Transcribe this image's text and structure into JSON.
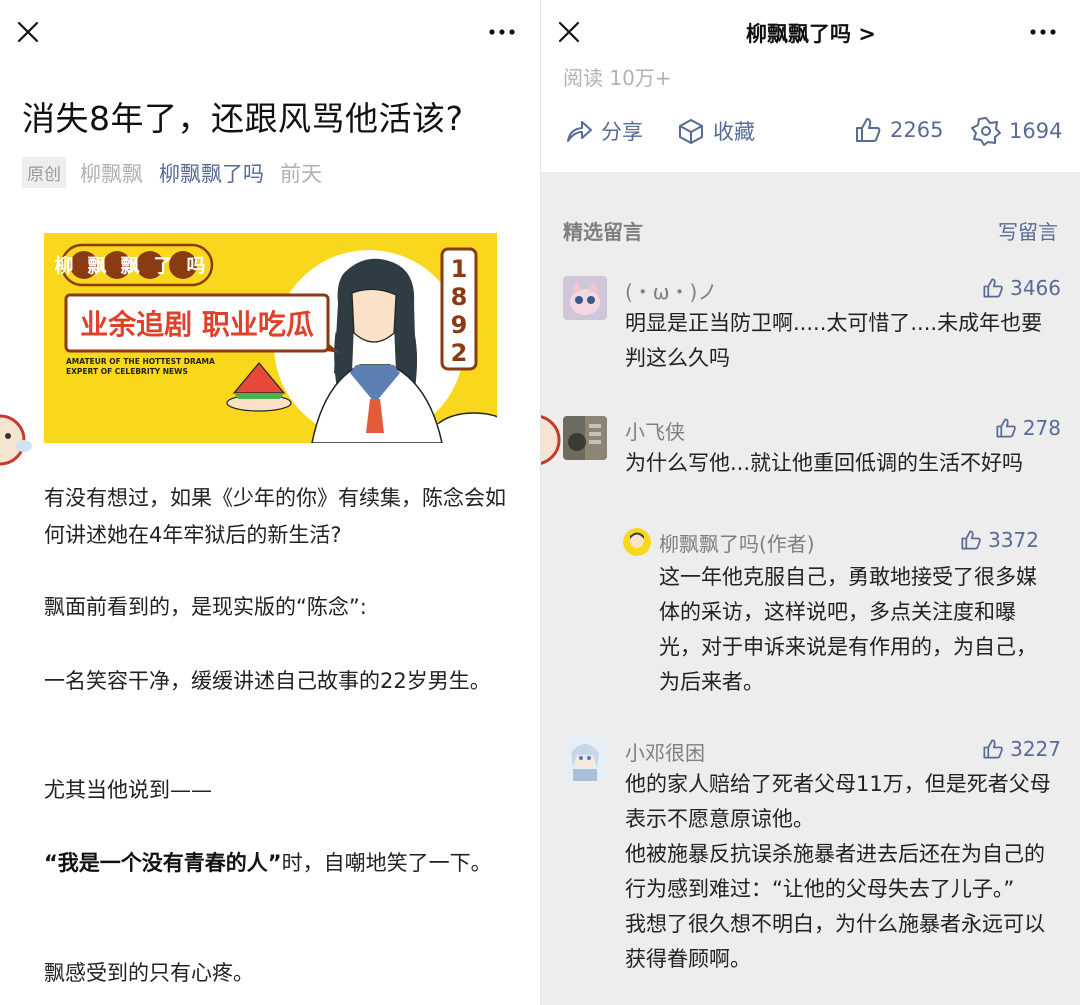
{
  "left": {
    "article": {
      "title": "消失8年了，还跟风骂他活该?",
      "badge": "原创",
      "author": "柳飘飘",
      "account": "柳飘飘了吗",
      "date": "前天"
    },
    "banner": {
      "brand": "柳飘飘了吗",
      "slogan": "业余追剧 职业吃瓜",
      "sub1": "AMATEUR OF THE HOTTEST DRAMA",
      "sub2": "EXPERT OF CELEBRITY NEWS",
      "digits": [
        "1",
        "8",
        "9",
        "2"
      ]
    },
    "paragraphs": {
      "p1": "有没有想过，如果《少年的你》有续集，陈念会如何讲述她在4年牢狱后的新生活?",
      "p2": "飘面前看到的，是现实版的“陈念”:",
      "p3": "一名笑容干净，缓缓讲述自己故事的22岁男生。",
      "p4": "尤其当他说到——",
      "p5_bold": "“我是一个没有青春的人”",
      "p5_rest": "时，自嘲地笑了一下。",
      "p6": "飘感受到的只有心疼。"
    }
  },
  "right": {
    "header": {
      "title": "柳飘飘了吗 >",
      "read_count": "阅读 10万+"
    },
    "actions": {
      "share": "分享",
      "favorite": "收藏",
      "like_count": "2265",
      "looking_count": "1694"
    },
    "comments_section": {
      "title": "精选留言",
      "write_label": "写留言",
      "comments": [
        {
          "nickname": "(・ω・)ノ",
          "likes": "3466",
          "text": "明显是正当防卫啊.....太可惜了....未成年也要判这么久吗"
        },
        {
          "nickname": "小飞侠",
          "likes": "278",
          "text": "为什么写他...就让他重回低调的生活不好吗",
          "reply": {
            "nickname": "柳飘飘了吗(作者)",
            "likes": "3372",
            "text": "这一年他克服自己，勇敢地接受了很多媒体的采访，这样说吧，多点关注度和曝光，对于申诉来说是有作用的，为自己，为后来者。"
          }
        },
        {
          "nickname": "小邓很困",
          "likes": "3227",
          "text_lines": [
            "他的家人赔给了死者父母11万，但是死者父母表示不愿意原谅他。",
            "他被施暴反抗误杀施暴者进去后还在为自己的行为感到难过：“让他的父母失去了儿子。”",
            "我想了很久想不明白，为什么施暴者永远可以获得眷顾啊。"
          ]
        }
      ]
    }
  },
  "colors": {
    "link_blue": "#576b95",
    "banner_yellow": "#f9d71c",
    "comments_bg": "#ededed"
  }
}
